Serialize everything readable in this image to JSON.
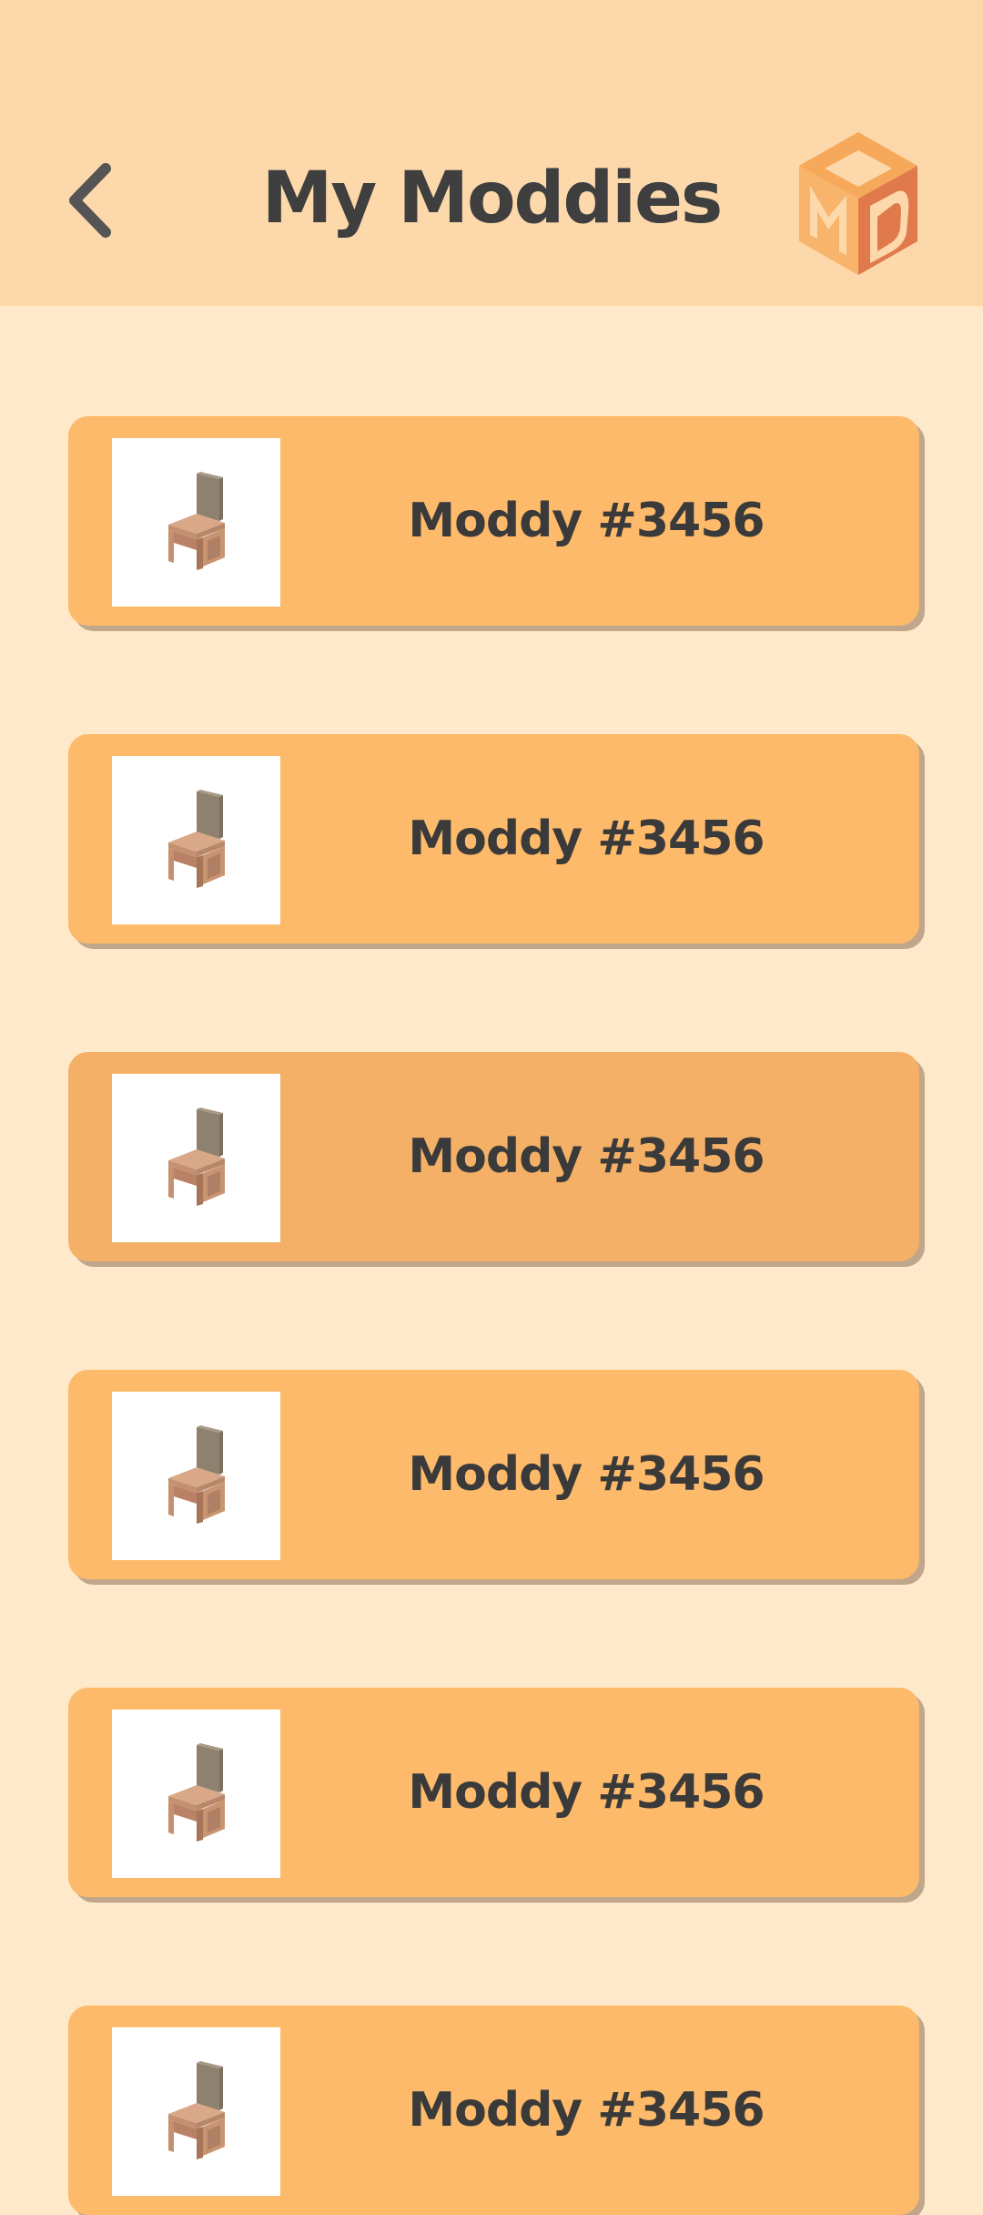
{
  "header": {
    "title": "My Moddies",
    "back_icon": "chevron-left-icon",
    "logo_icon": "md-cube-logo"
  },
  "colors": {
    "header_bg": "#FDD8AB",
    "page_bg": "#FEE9CB",
    "card_bg": "#FDBA6A",
    "card_pressed_bg": "#F4B066",
    "text": "#3F3F3F"
  },
  "moddies": [
    {
      "label": "Moddy #3456",
      "thumbnail_icon": "chair-icon"
    },
    {
      "label": "Moddy #3456",
      "thumbnail_icon": "chair-icon"
    },
    {
      "label": "Moddy #3456",
      "thumbnail_icon": "chair-icon",
      "pressed": true
    },
    {
      "label": "Moddy #3456",
      "thumbnail_icon": "chair-icon"
    },
    {
      "label": "Moddy #3456",
      "thumbnail_icon": "chair-icon"
    },
    {
      "label": "Moddy #3456",
      "thumbnail_icon": "chair-icon"
    }
  ]
}
